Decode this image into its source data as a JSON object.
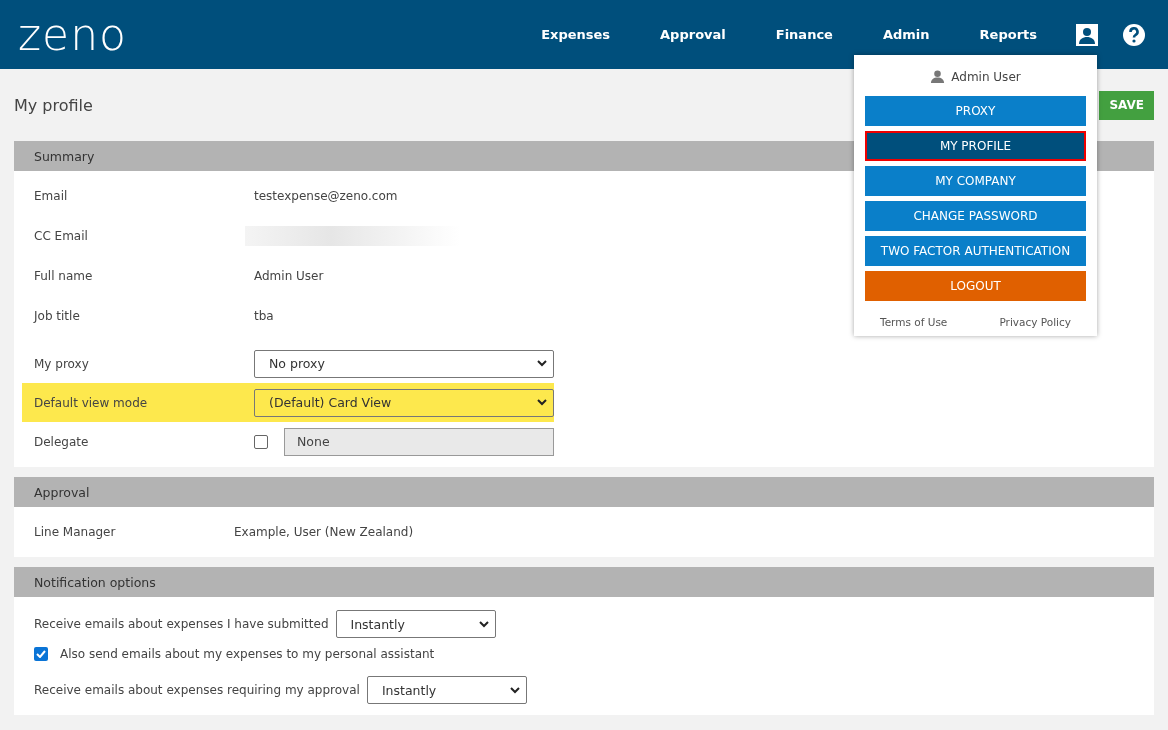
{
  "header": {
    "logo": "zeno",
    "nav": [
      "Expenses",
      "Approval",
      "Finance",
      "Admin",
      "Reports"
    ]
  },
  "page": {
    "title": "My profile",
    "save": "SAVE"
  },
  "summary": {
    "title": "Summary",
    "rows": [
      {
        "kind": "text",
        "label": "Email",
        "value": "testexpense@zeno.com",
        "highlighted": false
      },
      {
        "kind": "blurred",
        "label": "CC Email",
        "highlighted": false
      },
      {
        "kind": "text",
        "label": "Full name",
        "value": "Admin User",
        "highlighted": false
      },
      {
        "kind": "text",
        "label": "Job title",
        "value": "tba",
        "highlighted": false
      },
      {
        "kind": "select",
        "label": "My proxy",
        "value": "No proxy",
        "highlighted": false
      },
      {
        "kind": "select",
        "label": "Default view mode",
        "value": "(Default) Card View",
        "highlighted": true
      },
      {
        "kind": "delegate",
        "label": "Delegate",
        "value": "None",
        "checked": false,
        "highlighted": false
      }
    ]
  },
  "approval": {
    "title": "Approval",
    "rows": [
      {
        "label": "Line Manager",
        "value": "Example, User (New Zealand)"
      }
    ]
  },
  "notifications": {
    "title": "Notification options",
    "rows": [
      {
        "kind": "select",
        "label": "Receive emails about expenses I have submitted",
        "value": "Instantly"
      },
      {
        "kind": "checkbox",
        "label": "Also send emails about my expenses to my personal assistant",
        "checked": true
      },
      {
        "kind": "select",
        "label": "Receive emails about expenses requiring my approval",
        "value": "Instantly"
      }
    ]
  },
  "user_menu": {
    "user": "Admin User",
    "items": [
      {
        "label": "PROXY",
        "kind": "primary",
        "selected": false
      },
      {
        "label": "MY PROFILE",
        "kind": "primary",
        "selected": true
      },
      {
        "label": "MY COMPANY",
        "kind": "primary",
        "selected": false
      },
      {
        "label": "CHANGE PASSWORD",
        "kind": "primary",
        "selected": false
      },
      {
        "label": "TWO FACTOR AUTHENTICATION",
        "kind": "primary",
        "selected": false
      },
      {
        "label": "LOGOUT",
        "kind": "danger",
        "selected": false
      }
    ],
    "links": [
      "Terms of Use",
      "Privacy Policy"
    ]
  }
}
